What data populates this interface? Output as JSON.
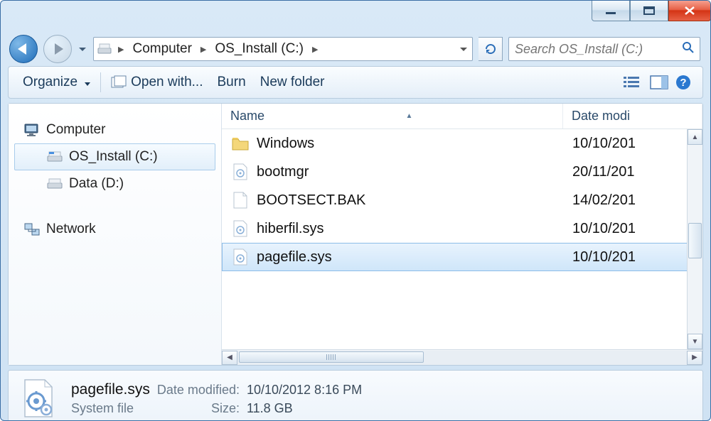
{
  "breadcrumb": {
    "seg1": "Computer",
    "seg2": "OS_Install (C:)"
  },
  "search": {
    "placeholder": "Search OS_Install (C:)"
  },
  "toolbar": {
    "organize": "Organize",
    "open_with": "Open with...",
    "burn": "Burn",
    "new_folder": "New folder"
  },
  "nav": {
    "computer": "Computer",
    "os_install": "OS_Install (C:)",
    "data_d": "Data (D:)",
    "network": "Network"
  },
  "columns": {
    "name": "Name",
    "date": "Date modi"
  },
  "files": [
    {
      "name": "Windows",
      "date": "10/10/201",
      "type": "folder"
    },
    {
      "name": "bootmgr",
      "date": "20/11/201",
      "type": "sys"
    },
    {
      "name": "BOOTSECT.BAK",
      "date": "14/02/201",
      "type": "file"
    },
    {
      "name": "hiberfil.sys",
      "date": "10/10/201",
      "type": "sys"
    },
    {
      "name": "pagefile.sys",
      "date": "10/10/201",
      "type": "sys",
      "selected": true
    }
  ],
  "details": {
    "filename": "pagefile.sys",
    "typedesc": "System file",
    "datemod_label": "Date modified:",
    "datemod_value": "10/10/2012 8:16 PM",
    "size_label": "Size:",
    "size_value": "11.8 GB"
  }
}
